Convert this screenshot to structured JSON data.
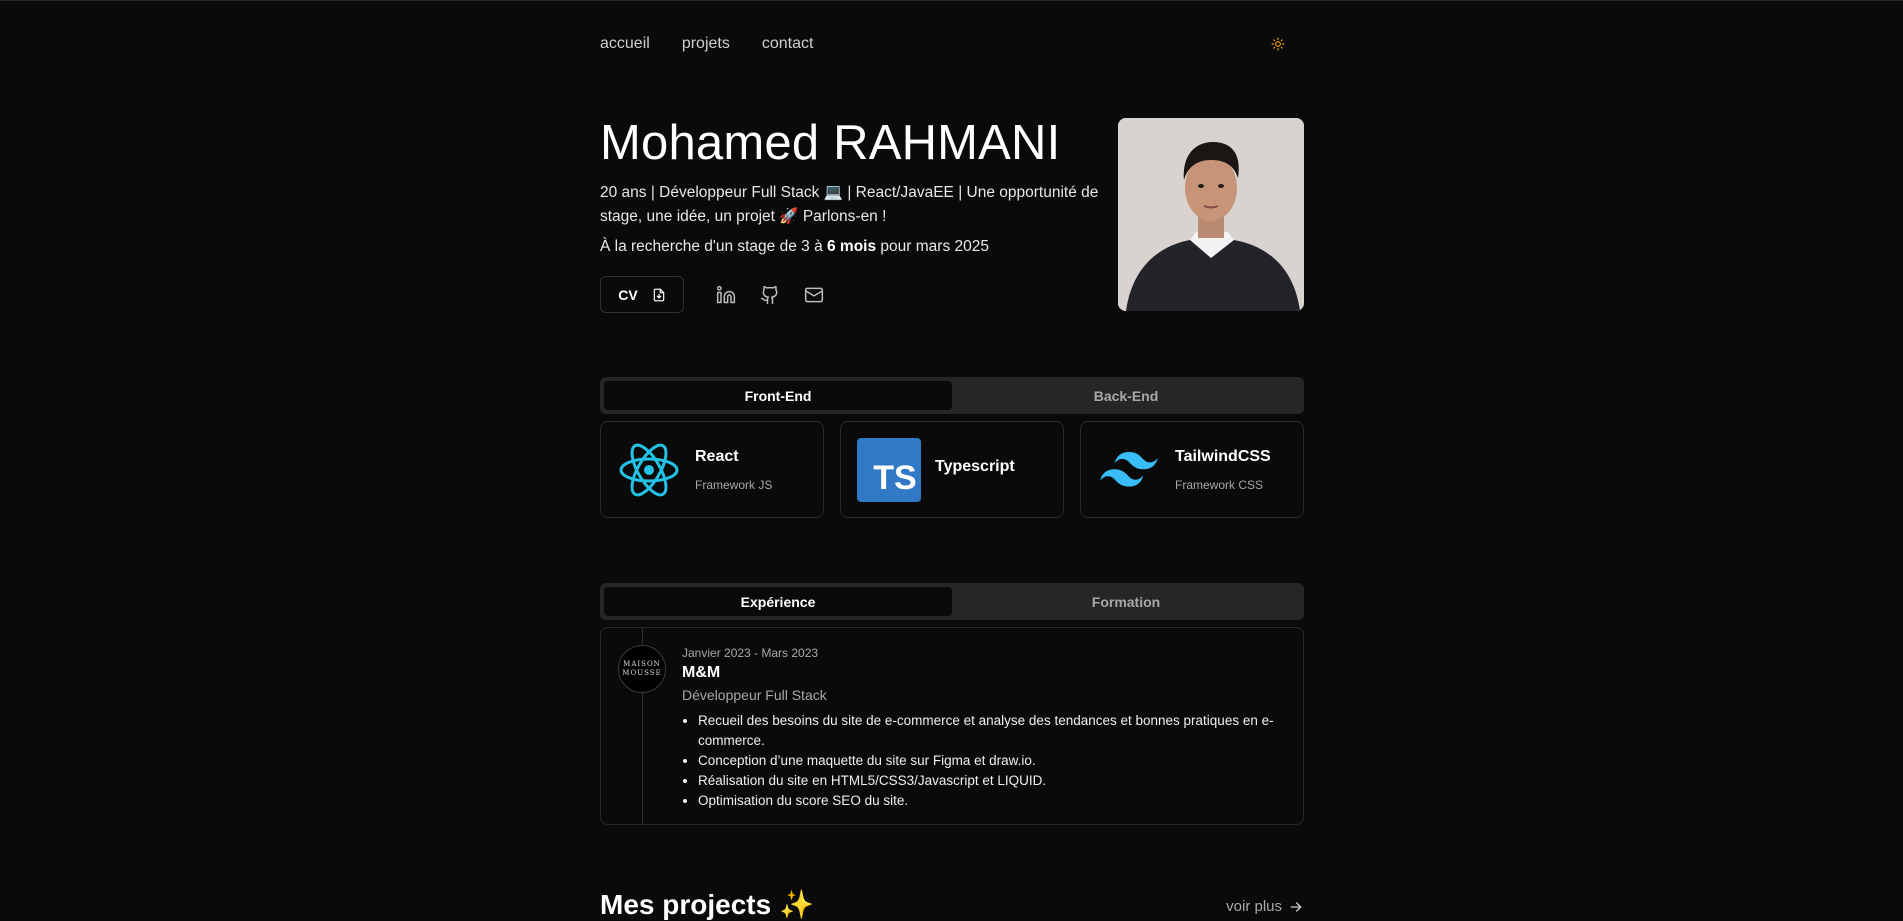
{
  "nav": {
    "items": [
      "accueil",
      "projets",
      "contact"
    ]
  },
  "hero": {
    "name": "Mohamed RAHMANI",
    "tagline": "20 ans | Développeur Full Stack 💻 | React/JavaEE | Une opportunité de stage, une idée, un projet 🚀 Parlons-en !",
    "search_prefix": "À la recherche d'un stage de 3 à ",
    "search_bold": "6 mois",
    "search_suffix": " pour mars 2025",
    "cv_label": "CV"
  },
  "skills_tabs": [
    "Front-End",
    "Back-End"
  ],
  "skills": [
    {
      "name": "React",
      "subtitle": "Framework JS",
      "icon": "react-logo"
    },
    {
      "name": "Typescript",
      "subtitle": "",
      "icon": "typescript-logo",
      "badge": "TS"
    },
    {
      "name": "TailwindCSS",
      "subtitle": "Framework CSS",
      "icon": "tailwind-logo"
    }
  ],
  "career_tabs": [
    "Expérience",
    "Formation"
  ],
  "experience": {
    "dates": "Janvier 2023 - Mars 2023",
    "company": "M&M",
    "role": "Développeur Full Stack",
    "logo_text_1": "MAISON",
    "logo_text_2": "MOUSSE",
    "items": [
      "Recueil des besoins du site de e-commerce et analyse des tendances et bonnes pratiques en e-commerce.",
      "Conception d’une maquette du site sur Figma et draw.io.",
      "Réalisation du site en HTML5/CSS3/Javascript et LIQUID.",
      "Optimisation du score SEO du site."
    ]
  },
  "projects": {
    "title": "Mes projects ✨",
    "see_more": "voir plus"
  },
  "colors": {
    "background": "#0a0a0a",
    "tab_bg": "#262626",
    "react": "#22c3e6",
    "typescript": "#3178c6",
    "tailwind": "#38bdf8",
    "sun": "#f5a623"
  }
}
